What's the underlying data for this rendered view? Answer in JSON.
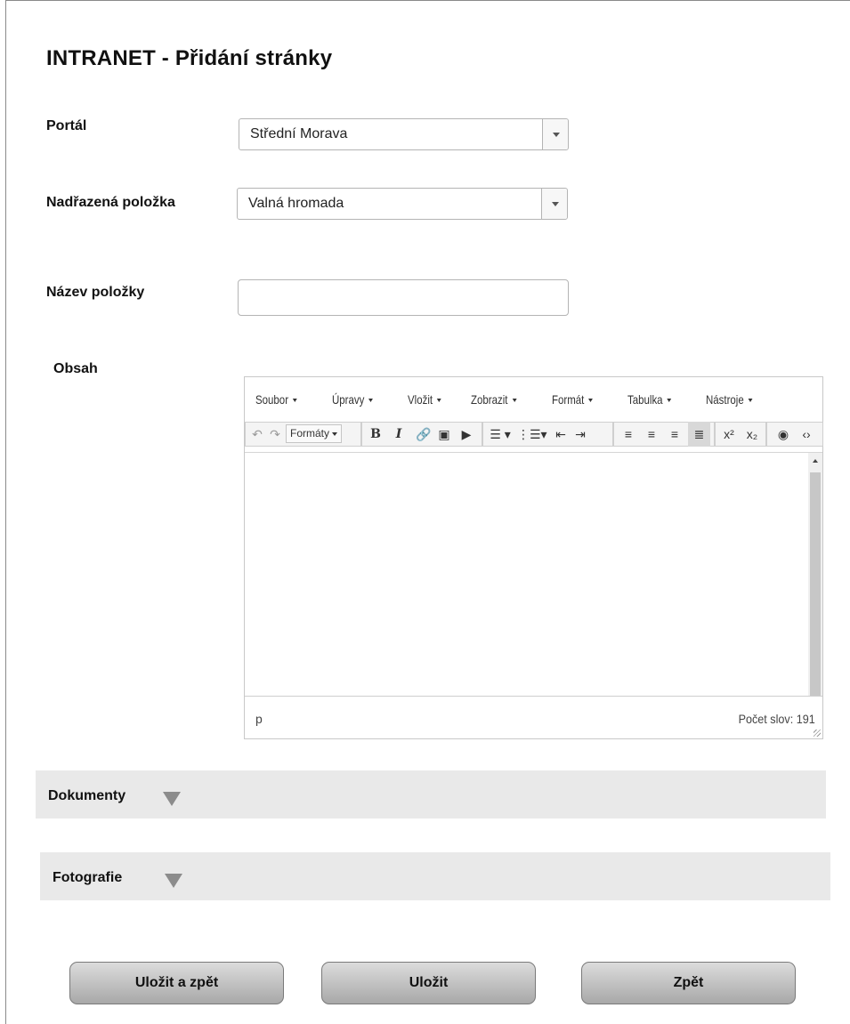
{
  "page": {
    "title": "INTRANET - Přidání stránky"
  },
  "form": {
    "portal": {
      "label": "Portál",
      "value": "Střední Morava"
    },
    "parent": {
      "label": "Nadřazená položka",
      "value": "Valná hromada"
    },
    "item_name": {
      "label": "Název položky",
      "value": "",
      "placeholder": ""
    },
    "content": {
      "label": "Obsah"
    }
  },
  "editor": {
    "menu": [
      "Soubor",
      "Úpravy",
      "Vložit",
      "Zobrazit",
      "Formát",
      "Tabulka",
      "Nástroje"
    ],
    "formats_label": "Formáty",
    "toolbar_icons": [
      "undo-icon",
      "redo-icon",
      "formats-dropdown",
      "bold-icon",
      "italic-icon",
      "link-icon",
      "image-icon",
      "media-icon",
      "bullet-list-icon",
      "numbered-list-icon",
      "outdent-icon",
      "indent-icon",
      "align-left-icon",
      "align-center-icon",
      "align-right-icon",
      "align-justify-icon",
      "superscript-icon",
      "subscript-icon",
      "preview-icon",
      "source-code-icon"
    ],
    "status_path": "p",
    "word_count": "Počet slov: 191"
  },
  "sections": {
    "documents": "Dokumenty",
    "photos": "Fotografie"
  },
  "buttons": {
    "save_back": "Uložit a zpět",
    "save": "Uložit",
    "back": "Zpět"
  }
}
